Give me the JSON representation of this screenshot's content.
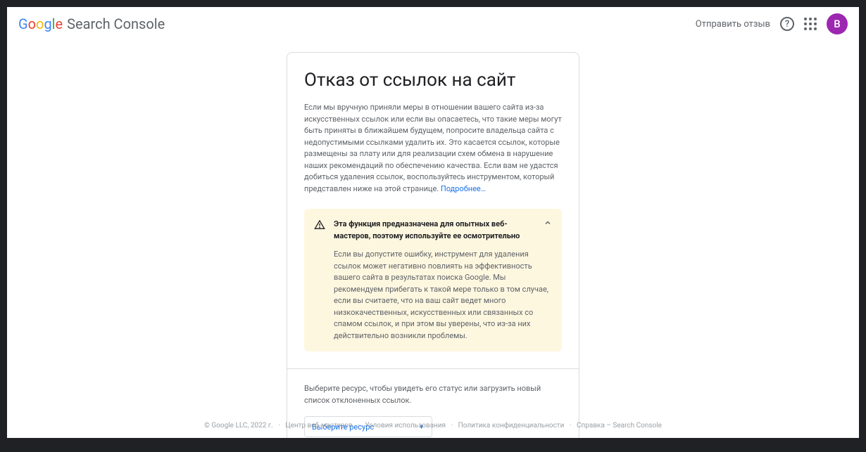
{
  "header": {
    "logo_text": "Search Console",
    "feedback": "Отправить отзыв",
    "avatar_initial": "В"
  },
  "main": {
    "title": "Отказ от ссылок на сайт",
    "description": "Если мы вручную приняли меры в отношении вашего сайта из-за искусственных ссылок или если вы опасаетесь, что такие меры могут быть приняты в ближайшем будущем, попросите владельца сайта с недопустимыми ссылками удалить их. Это касается ссылок, которые размещены за плату или для реализации схем обмена в нарушение наших рекомендаций по обеспечению качества. Если вам не удастся добиться удаления ссылок, воспользуйтесь инструментом, который представлен ниже на этой странице. ",
    "more_link": "Подробнее…",
    "warning": {
      "title": "Эта функция предназначена для опытных веб-мастеров, поэтому используйте ее осмотрительно",
      "body": "Если вы допустите ошибку, инструмент для удаления ссылок может негативно повлиять на эффективность вашего сайта в результатах поиска Google. Мы рекомендуем прибегать к такой мере только в том случае, если вы считаете, что на ваш сайт ведет много низкокачественных, искусственных или связанных со спамом ссылок, и при этом вы уверены, что из-за них действительно возникли проблемы."
    },
    "select_prompt": "Выберите ресурс, чтобы увидеть его статус или загрузить новый список отклоненных ссылок.",
    "dropdown_label": "Выберите ресурс"
  },
  "footer": {
    "copyright": "© Google LLC, 2022 г.",
    "links": [
      "Центр веб-мастеров",
      "Условия использования",
      "Политика конфиденциальности",
      "Справка – Search Console"
    ]
  }
}
